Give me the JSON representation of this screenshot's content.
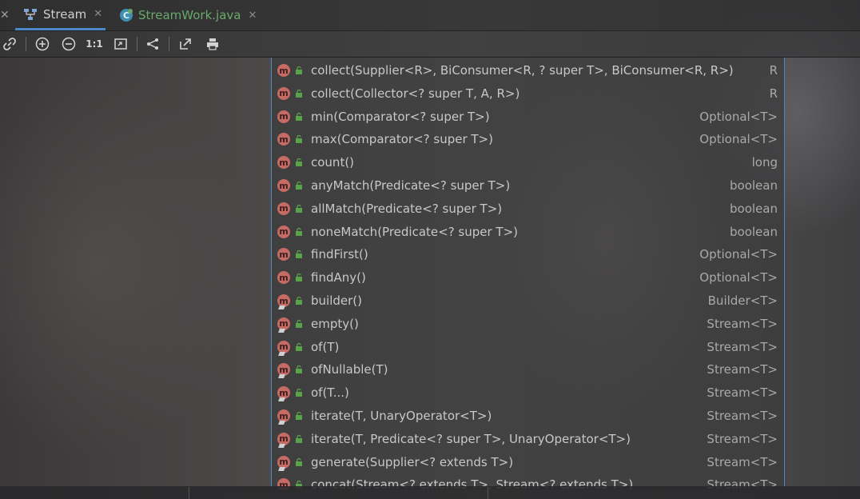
{
  "tabs": [
    {
      "label": "Stream",
      "icon": "hierarchy-diagram-icon",
      "active": true
    },
    {
      "label": "StreamWork.java",
      "icon": "java-class-icon",
      "active": false
    }
  ],
  "toolbar": {
    "actual_size_label": "1:1",
    "buttons": [
      "link-icon",
      "zoom-in-icon",
      "zoom-out-icon",
      "actual-size",
      "fit-content-icon",
      "layout-icon",
      "export-icon",
      "print-icon"
    ]
  },
  "methods": [
    {
      "signature": "collect(Supplier<R>, BiConsumer<R, ? super T>, BiConsumer<R, R>)",
      "type": "R",
      "abstract": false
    },
    {
      "signature": "collect(Collector<? super T, A, R>)",
      "type": "R",
      "abstract": false
    },
    {
      "signature": "min(Comparator<? super T>)",
      "type": "Optional<T>",
      "abstract": false
    },
    {
      "signature": "max(Comparator<? super T>)",
      "type": "Optional<T>",
      "abstract": false
    },
    {
      "signature": "count()",
      "type": "long",
      "abstract": false
    },
    {
      "signature": "anyMatch(Predicate<? super T>)",
      "type": "boolean",
      "abstract": false
    },
    {
      "signature": "allMatch(Predicate<? super T>)",
      "type": "boolean",
      "abstract": false
    },
    {
      "signature": "noneMatch(Predicate<? super T>)",
      "type": "boolean",
      "abstract": false
    },
    {
      "signature": "findFirst()",
      "type": "Optional<T>",
      "abstract": false
    },
    {
      "signature": "findAny()",
      "type": "Optional<T>",
      "abstract": false
    },
    {
      "signature": "builder()",
      "type": "Builder<T>",
      "abstract": true
    },
    {
      "signature": "empty()",
      "type": "Stream<T>",
      "abstract": true
    },
    {
      "signature": "of(T)",
      "type": "Stream<T>",
      "abstract": true
    },
    {
      "signature": "ofNullable(T)",
      "type": "Stream<T>",
      "abstract": true
    },
    {
      "signature": "of(T...)",
      "type": "Stream<T>",
      "abstract": true
    },
    {
      "signature": "iterate(T, UnaryOperator<T>)",
      "type": "Stream<T>",
      "abstract": true
    },
    {
      "signature": "iterate(T, Predicate<? super T>, UnaryOperator<T>)",
      "type": "Stream<T>",
      "abstract": true
    },
    {
      "signature": "generate(Supplier<? extends T>)",
      "type": "Stream<T>",
      "abstract": true
    },
    {
      "signature": "concat(Stream<? extends T>, Stream<? extends T>)",
      "type": "Stream<T>",
      "abstract": true
    }
  ],
  "colors": {
    "accent": "#4a88c7",
    "method_badge": "#c86a64",
    "lock_icon": "#59a24a",
    "java_tab_text": "#6aa86a"
  }
}
